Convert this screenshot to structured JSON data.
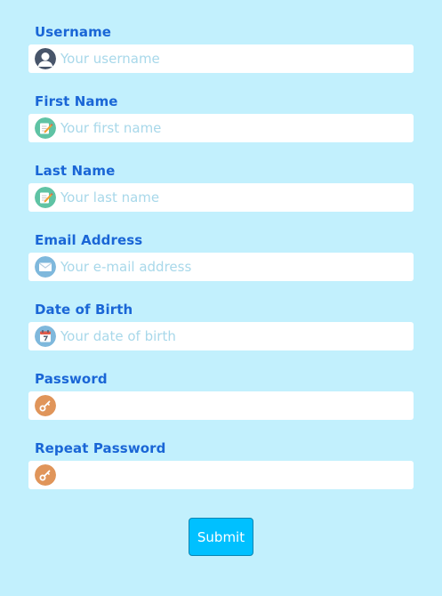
{
  "form": {
    "fields": [
      {
        "label": "Username",
        "placeholder": "Your username",
        "icon": "user-icon"
      },
      {
        "label": "First Name",
        "placeholder": "Your first name",
        "icon": "edit-icon"
      },
      {
        "label": "Last Name",
        "placeholder": "Your last name",
        "icon": "edit-icon"
      },
      {
        "label": "Email Address",
        "placeholder": "Your e-mail address",
        "icon": "envelope-icon"
      },
      {
        "label": "Date of Birth",
        "placeholder": "Your date of birth",
        "icon": "calendar-icon"
      },
      {
        "label": "Password",
        "placeholder": "",
        "icon": "key-icon"
      },
      {
        "label": "Repeat Password",
        "placeholder": "",
        "icon": "key-icon"
      }
    ],
    "submit_label": "Submit"
  },
  "colors": {
    "background": "#c2f0fd",
    "label": "#1a66d6",
    "placeholder": "#a8d8ea",
    "button": "#00c0ff",
    "button_border": "#0a86b3"
  }
}
